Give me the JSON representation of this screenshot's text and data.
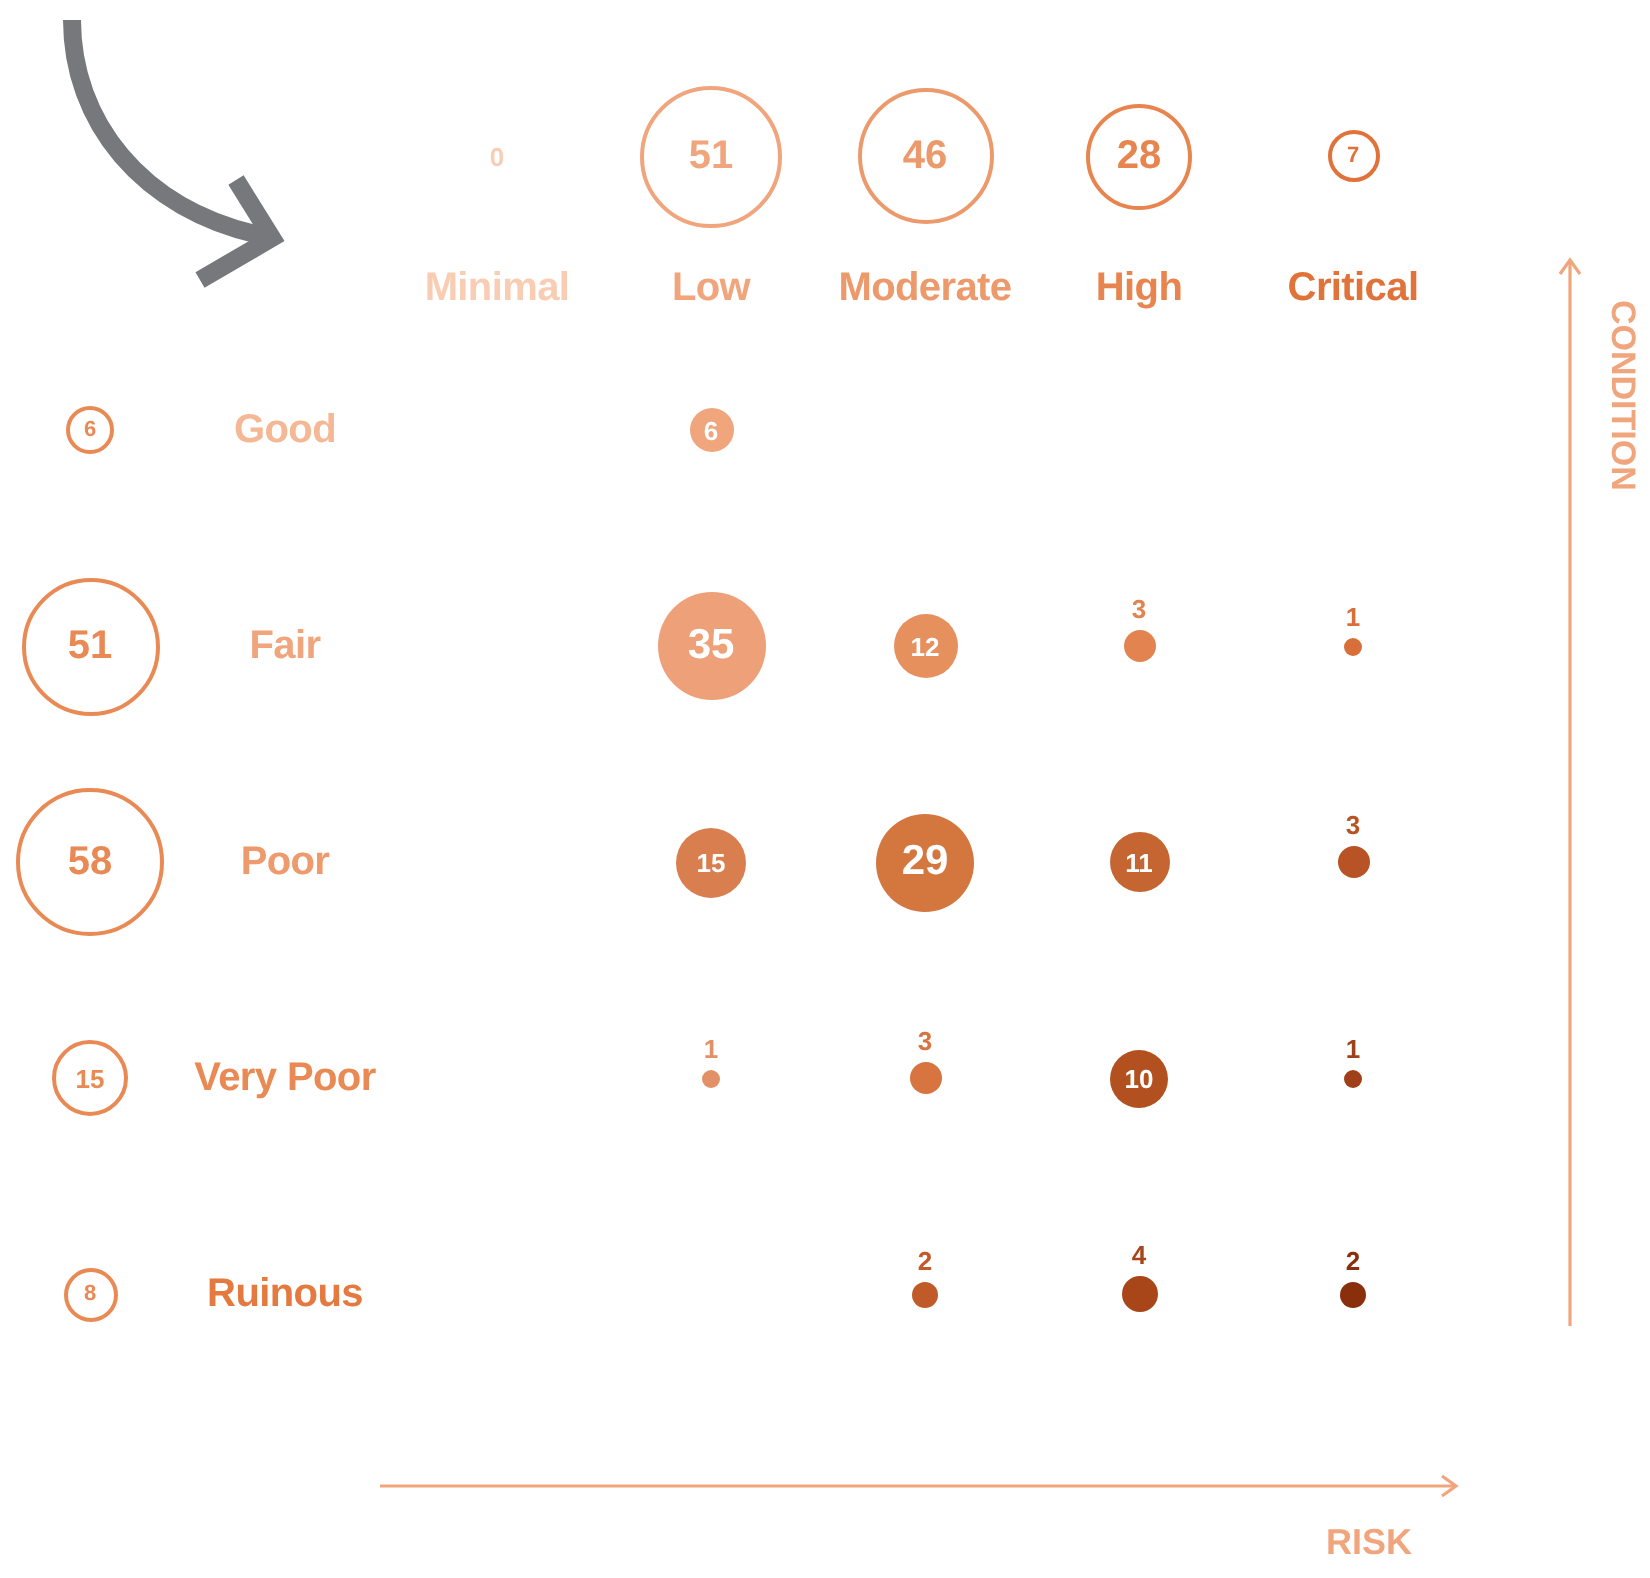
{
  "columns": [
    {
      "label": "Minimal",
      "total": "0",
      "color": "#f8cdb3"
    },
    {
      "label": "Low",
      "total": "51",
      "color": "#f0a57d"
    },
    {
      "label": "Moderate",
      "total": "46",
      "color": "#ec9a6c"
    },
    {
      "label": "High",
      "total": "28",
      "color": "#e8854f"
    },
    {
      "label": "Critical",
      "total": "7",
      "color": "#e0733a"
    }
  ],
  "rows": [
    {
      "label": "Good",
      "total": "6",
      "color": "#f5b895",
      "cells": [
        null,
        {
          "value": "6",
          "color": "#f0a57d"
        },
        null,
        null,
        null
      ]
    },
    {
      "label": "Fair",
      "total": "51",
      "color": "#f0a57d",
      "cells": [
        null,
        {
          "value": "35",
          "color": "#eea078"
        },
        {
          "value": "12",
          "color": "#e6905e"
        },
        {
          "value": "3",
          "color": "#e28350"
        },
        {
          "value": "1",
          "color": "#d86f3a"
        }
      ]
    },
    {
      "label": "Poor",
      "total": "58",
      "color": "#ee9a6c",
      "cells": [
        null,
        {
          "value": "15",
          "color": "#d97e4f"
        },
        {
          "value": "29",
          "color": "#d4773f"
        },
        {
          "value": "11",
          "color": "#c56632"
        },
        {
          "value": "3",
          "color": "#b85326"
        }
      ]
    },
    {
      "label": "Very Poor",
      "total": "15",
      "color": "#e98a55",
      "cells": [
        null,
        {
          "value": "1",
          "color": "#e29066"
        },
        {
          "value": "3",
          "color": "#d8743f"
        },
        {
          "value": "10",
          "color": "#b2511f"
        },
        {
          "value": "1",
          "color": "#a04018"
        }
      ]
    },
    {
      "label": "Ruinous",
      "total": "8",
      "color": "#e47a40",
      "cells": [
        null,
        null,
        {
          "value": "2",
          "color": "#c05a28"
        },
        {
          "value": "4",
          "color": "#a8461a"
        },
        {
          "value": "2",
          "color": "#8a2f0c"
        }
      ]
    }
  ],
  "y_axis": {
    "label": "CONDITION"
  },
  "x_axis": {
    "label": "RISK"
  }
}
